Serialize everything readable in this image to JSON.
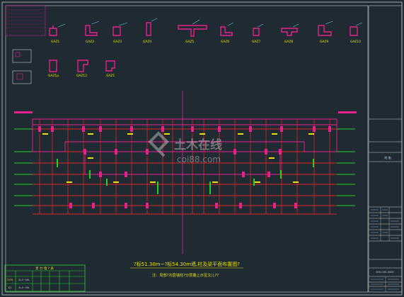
{
  "drawing": {
    "title_main": "?标51.30m~?标54.30m墙,柱及梁平面布置图?",
    "note": "注：局部?次层墙柱?分层叠上示至文儿??",
    "watermark_main": "土木在线",
    "watermark_sub": "coi88.com"
  },
  "details": {
    "row1": [
      "GAZ1",
      "GAZ2",
      "GAZ3",
      "GAZ4",
      "GAZ5",
      "GAZ6",
      "GAZ7",
      "GAZ8",
      "GAZ9",
      "GAZ10"
    ],
    "row2": [
      "GAZ1p",
      "GAZ12",
      "GAZ1"
    ]
  },
  "legend": {
    "title": "剪 力 墙 ? 表",
    "rows": [
      {
        "mark": "?370",
        "section": "0L.0~00L"
      },
      {
        "mark": "Q1",
        "section": "0L.0~00L"
      }
    ]
  },
  "title_block": {
    "sheet_label": "结 施",
    "drawing_code": "000-000-0000"
  },
  "colors": {
    "background": "#1f2a33",
    "wall": "#e8208c",
    "grid_red": "#e02424",
    "grid_green": "#22d422",
    "frame": "#c8c8c8",
    "label_yellow": "#e8e000"
  }
}
